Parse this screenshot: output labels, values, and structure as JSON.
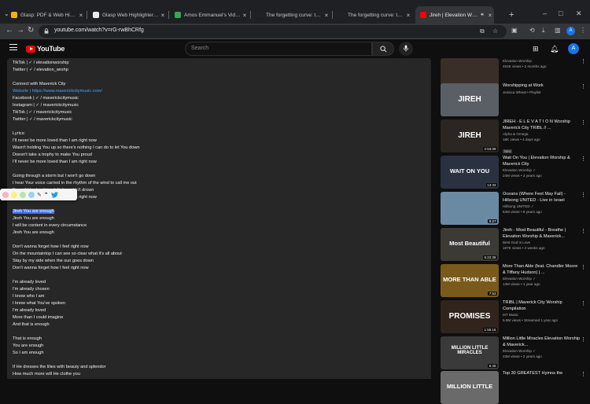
{
  "browser": {
    "tabs": [
      {
        "title": "Glasp: PDF & Web Highlighter",
        "color": "#f4b400"
      },
      {
        "title": "Glasp Web Highlighter - PDF",
        "color": "#e8eaed"
      },
      {
        "title": "Amos Emmanuel's Video",
        "color": "#34a853"
      },
      {
        "title": "The forgetting curve: the sci",
        "color": "#202124"
      },
      {
        "title": "The forgetting curve: the sci",
        "color": "#202124"
      },
      {
        "title": "Jireh | Elevation Worship",
        "color": "#ff0000",
        "active": true
      }
    ],
    "new_tab": "+",
    "url": "youtube.com/watch?v=rG-rwBhCRfg",
    "profile_initial": "A"
  },
  "youtube": {
    "logo_text": "YouTube",
    "search_placeholder": "Search",
    "avatar_initial": "A"
  },
  "description": {
    "lines": [
      {
        "text": "TikTok | ✓ / elevationworship"
      },
      {
        "text": "Twitter | ✓ / elevation_wrshp"
      },
      {
        "text": ""
      },
      {
        "text": "Connect with Maverick City"
      },
      {
        "text": "Website | https://www.maverickcitymusic.com/",
        "link": true
      },
      {
        "text": "Facebook | ✓ / maverickcitymusic"
      },
      {
        "text": "Instagram | ✓ / maverickcitymusic"
      },
      {
        "text": "TikTok | ✓ / maverickcitymusic"
      },
      {
        "text": "Twitter | ✓ / maverickcitymusic"
      },
      {
        "text": ""
      },
      {
        "text": "Lyrics:"
      },
      {
        "text": "I'll never be more loved than I am right now"
      },
      {
        "text": "Wasn't holding You up so there's nothing I can do to let You down"
      },
      {
        "text": "Doesn't take a trophy to make You proud"
      },
      {
        "text": "I'll never be more loved than I am right now"
      },
      {
        "text": ""
      },
      {
        "text": "Going through a storm but I won't go down"
      },
      {
        "text": "I hear Your voice carried in the rhythm of the wind to call me out"
      },
      {
        "text": "Even if I had nothing left, I wouldn't drown"
      },
      {
        "text": "I'll never be more loved than I am right now"
      },
      {
        "text": ""
      },
      {
        "text": "Jireh You are enough",
        "highlight": true
      },
      {
        "text": "Jireh You are enough"
      },
      {
        "text": "I will be content in every circumstance"
      },
      {
        "text": "Jireh You are enough"
      },
      {
        "text": ""
      },
      {
        "text": "Don't wanna forget how I feel right now"
      },
      {
        "text": "On the mountaintop I can see so clear what it's all about"
      },
      {
        "text": "Stay by my side when the sun goes down"
      },
      {
        "text": "Don't wanna forget how I feel right now"
      },
      {
        "text": ""
      },
      {
        "text": "I'm already loved"
      },
      {
        "text": "I'm already chosen"
      },
      {
        "text": "I know who I am"
      },
      {
        "text": "I know what You've spoken"
      },
      {
        "text": "I'm already loved"
      },
      {
        "text": "More than I could imagine"
      },
      {
        "text": "And that is enough"
      },
      {
        "text": ""
      },
      {
        "text": "That is enough"
      },
      {
        "text": "You are enough"
      },
      {
        "text": "So I am enough"
      },
      {
        "text": ""
      },
      {
        "text": "If He dresses the lilies with beauty and splendor"
      },
      {
        "text": "How much more will He clothe you"
      },
      {
        "text": "If He watches over every sparrow"
      }
    ]
  },
  "highlighter_toolbar": {
    "colors": [
      "#f8b4c0",
      "#fff07a",
      "#b4e7a6",
      "#9fd0f5"
    ],
    "icons": [
      "pencil-icon",
      "quote-icon",
      "twitter-icon"
    ]
  },
  "recommendations": [
    {
      "title": "",
      "channel": "Elevation Worship",
      "stats": "453K views • 2 months ago",
      "duration": "53:40",
      "thumb": "#3a2f28",
      "overlay": ""
    },
    {
      "title": "Worshipping at Work",
      "channel": "Jessica Wheat • Playlist",
      "stats": "",
      "duration": "",
      "thumb": "#5a5f66",
      "overlay": "JIREH"
    },
    {
      "title": "JIREH - E L E V A T I O N Worship Maverick City TRIBL // ...",
      "channel": "Alpha & Omega",
      "stats": "18K views • 4 days ago",
      "duration": "2:53:09",
      "badge": "New",
      "thumb": "#2b2622",
      "overlay": "JIREH"
    },
    {
      "title": "Wait On You | Elevation Worship & Maverick City",
      "channel": "Elevation Worship ✓",
      "stats": "24M views • 3 years ago",
      "duration": "13:33",
      "thumb": "#2a3140",
      "overlay": "WAIT ON YOU"
    },
    {
      "title": "Oceans (Where Feet May Fail) - Hillsong UNITED - Live in Israel",
      "channel": "Hillsong UNITED ✓",
      "stats": "64M views • 8 years ago",
      "duration": "9:27",
      "thumb": "#6a8aa4",
      "overlay": ""
    },
    {
      "title": "Jireh - Most Beautiful - Breathe | Elevation Worship & Maverick...",
      "channel": "Best God Is Love",
      "stats": "187K views • 2 weeks ago",
      "duration": "5:22:28",
      "thumb": "#3b3a34",
      "overlay": "Most Beautiful"
    },
    {
      "title": "More Than Able (feat. Chandler Moore & Tiffany Hudson) | ...",
      "channel": "Elevation Worship ✓",
      "stats": "13M views • 1 year ago",
      "duration": "7:53",
      "thumb": "#7a5a1a",
      "overlay": "MORE THAN ABLE"
    },
    {
      "title": "TRIBL | Maverick City Worship Compilation",
      "channel": "MT Music",
      "stats": "5.9M views • Streamed 1 year ago",
      "duration": "1:55:16",
      "thumb": "#30241c",
      "overlay": "PROMISES"
    },
    {
      "title": "Million Little Miracles Elevation Worship & Maverick...",
      "channel": "Elevation Worship ✓",
      "stats": "23M views • 2 years ago",
      "duration": "6:45",
      "thumb": "#3a3a3a",
      "overlay": "MILLION LITTLE MIRACLES"
    },
    {
      "title": "Top 30 GREATEST Hymns the",
      "channel": "",
      "stats": "",
      "duration": "",
      "thumb": "#6a6a6a",
      "overlay": "MILLION LITTLE"
    }
  ]
}
